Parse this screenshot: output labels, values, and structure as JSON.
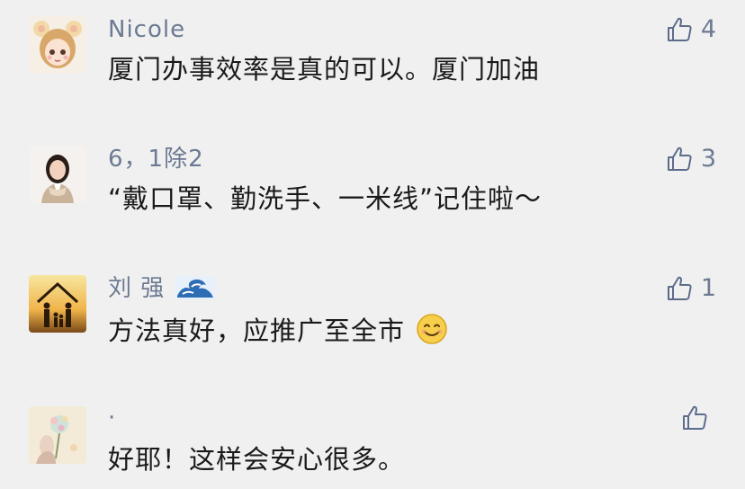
{
  "comments": [
    {
      "author": "Nicole",
      "text": "厦门办事效率是真的可以。厦门加油",
      "likes": "4",
      "avatar_icon": "girl-avatar-icon"
    },
    {
      "author": "6，1除2",
      "text": "“戴口罩、勤洗手、一米线”记住啦～",
      "likes": "3",
      "avatar_icon": "woman-photo-avatar-icon"
    },
    {
      "author": "刘 强",
      "author_emoji": "wave-emoji",
      "text": "方法真好，应推广至全市",
      "text_emoji": "smiling-face-emoji",
      "likes": "1",
      "avatar_icon": "family-sunset-avatar-icon"
    },
    {
      "author": "·",
      "text": "好耶！这样会安心很多。",
      "likes": "",
      "avatar_icon": "floral-illustration-avatar-icon"
    }
  ],
  "colors": {
    "background": "#f0f0f0",
    "name": "#6c7a92",
    "text": "#1a1a1a",
    "like_icon": "#5c6d8c"
  }
}
